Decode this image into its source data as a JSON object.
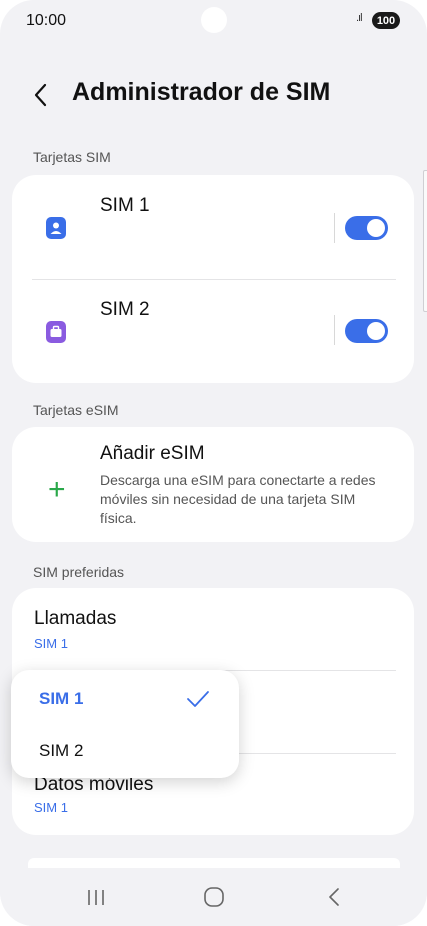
{
  "status": {
    "time": "10:00",
    "signal": ".ıl",
    "battery": "100"
  },
  "header": {
    "title": "Administrador de SIM"
  },
  "sections": {
    "sim_cards": "Tarjetas SIM",
    "esim_cards": "Tarjetas eSIM",
    "preferred": "SIM preferidas"
  },
  "sim_cards": [
    {
      "label": "SIM 1",
      "enabled": true,
      "icon": "person-sim-icon",
      "color": "#3a6ee8"
    },
    {
      "label": "SIM 2",
      "enabled": true,
      "icon": "briefcase-sim-icon",
      "color": "#8a5be0"
    }
  ],
  "esim": {
    "title": "Añadir eSIM",
    "description": "Descarga una eSIM para conectarte a redes móviles sin necesidad de una tarjeta SIM física."
  },
  "preferred": {
    "calls_label": "Llamadas",
    "calls_value": "SIM 1",
    "data_label": "Datos móviles",
    "data_value": "SIM 1"
  },
  "dropdown": {
    "options": [
      {
        "label": "SIM 1",
        "selected": true
      },
      {
        "label": "SIM 2",
        "selected": false
      }
    ]
  },
  "colors": {
    "accent": "#3a6ee8",
    "esim_plus": "#2aa84a",
    "background": "#f2f2f5"
  }
}
